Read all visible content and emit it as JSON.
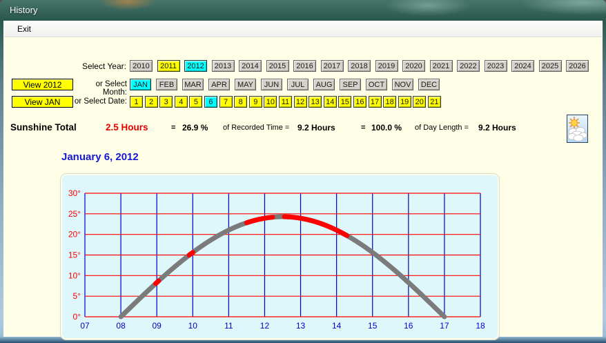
{
  "window": {
    "title": "History"
  },
  "menu": {
    "exit": "Exit"
  },
  "selectors": {
    "year_label": "Select Year:",
    "years": [
      {
        "label": "2010",
        "state": "normal"
      },
      {
        "label": "2011",
        "state": "yellow"
      },
      {
        "label": "2012",
        "state": "cyan"
      },
      {
        "label": "2013",
        "state": "normal"
      },
      {
        "label": "2014",
        "state": "normal"
      },
      {
        "label": "2015",
        "state": "normal"
      },
      {
        "label": "2016",
        "state": "normal"
      },
      {
        "label": "2017",
        "state": "normal"
      },
      {
        "label": "2018",
        "state": "normal"
      },
      {
        "label": "2019",
        "state": "normal"
      },
      {
        "label": "2020",
        "state": "normal"
      },
      {
        "label": "2021",
        "state": "normal"
      },
      {
        "label": "2022",
        "state": "normal"
      },
      {
        "label": "2023",
        "state": "normal"
      },
      {
        "label": "2024",
        "state": "normal"
      },
      {
        "label": "2025",
        "state": "normal"
      },
      {
        "label": "2026",
        "state": "normal"
      }
    ],
    "view_year_button": "View 2012",
    "month_label": "or Select Month:",
    "months": [
      {
        "label": "JAN",
        "state": "cyan"
      },
      {
        "label": "FEB",
        "state": "normal"
      },
      {
        "label": "MAR",
        "state": "normal"
      },
      {
        "label": "APR",
        "state": "normal"
      },
      {
        "label": "MAY",
        "state": "normal"
      },
      {
        "label": "JUN",
        "state": "normal"
      },
      {
        "label": "JUL",
        "state": "normal"
      },
      {
        "label": "AUG",
        "state": "normal"
      },
      {
        "label": "SEP",
        "state": "normal"
      },
      {
        "label": "OCT",
        "state": "normal"
      },
      {
        "label": "NOV",
        "state": "normal"
      },
      {
        "label": "DEC",
        "state": "normal"
      }
    ],
    "view_month_button": "View JAN",
    "date_label": "or Select Date:",
    "dates": [
      {
        "label": "1",
        "state": "yellow"
      },
      {
        "label": "2",
        "state": "yellow"
      },
      {
        "label": "3",
        "state": "yellow"
      },
      {
        "label": "4",
        "state": "yellow"
      },
      {
        "label": "5",
        "state": "yellow"
      },
      {
        "label": "6",
        "state": "cyan"
      },
      {
        "label": "7",
        "state": "yellow"
      },
      {
        "label": "8",
        "state": "yellow"
      },
      {
        "label": "9",
        "state": "yellow"
      },
      {
        "label": "10",
        "state": "yellow"
      },
      {
        "label": "11",
        "state": "yellow"
      },
      {
        "label": "12",
        "state": "yellow"
      },
      {
        "label": "13",
        "state": "yellow"
      },
      {
        "label": "14",
        "state": "yellow"
      },
      {
        "label": "15",
        "state": "yellow"
      },
      {
        "label": "16",
        "state": "yellow"
      },
      {
        "label": "17",
        "state": "yellow"
      },
      {
        "label": "18",
        "state": "yellow"
      },
      {
        "label": "19",
        "state": "yellow"
      },
      {
        "label": "20",
        "state": "yellow"
      },
      {
        "label": "21",
        "state": "yellow"
      }
    ]
  },
  "summary": {
    "title": "Sunshine Total",
    "sunshine_value": "2.5 Hours",
    "eq1": "=",
    "recorded_pct": "26.9 %",
    "recorded_label": "of Recorded Time =",
    "recorded_value": "9.2 Hours",
    "eq2": "=",
    "daylength_pct": "100.0 %",
    "daylength_label": "of Day Length =",
    "daylength_value": "9.2 Hours",
    "weather_icon": "sun-behind-cloud"
  },
  "chart_data": {
    "type": "line",
    "title": "January 6, 2012",
    "title_color": "#1717d2",
    "x_axis": {
      "ticks": [
        "07",
        "08",
        "09",
        "10",
        "11",
        "12",
        "13",
        "14",
        "15",
        "16",
        "17",
        "18"
      ],
      "range": [
        7,
        18
      ],
      "color": "#0000c8"
    },
    "y_axis": {
      "ticks": [
        "0°",
        "5°",
        "10°",
        "15°",
        "20°",
        "25°",
        "30°"
      ],
      "range": [
        0,
        30
      ],
      "step": 5,
      "color": "#ff0000"
    },
    "grid": {
      "h_color": "#ff0000",
      "v_color": "#0000c8"
    },
    "series": [
      {
        "name": "sun-elevation-arc",
        "color": "#7b7b7b",
        "model": "sine",
        "sunrise": 8.0,
        "sunset": 17.0,
        "peak_elevation": 24.3
      },
      {
        "name": "sunshine-periods",
        "color": "#ff0000",
        "segments": [
          [
            8.97,
            9.06
          ],
          [
            9.9,
            10.0
          ],
          [
            11.5,
            12.22
          ],
          [
            12.55,
            14.3
          ]
        ]
      }
    ]
  }
}
